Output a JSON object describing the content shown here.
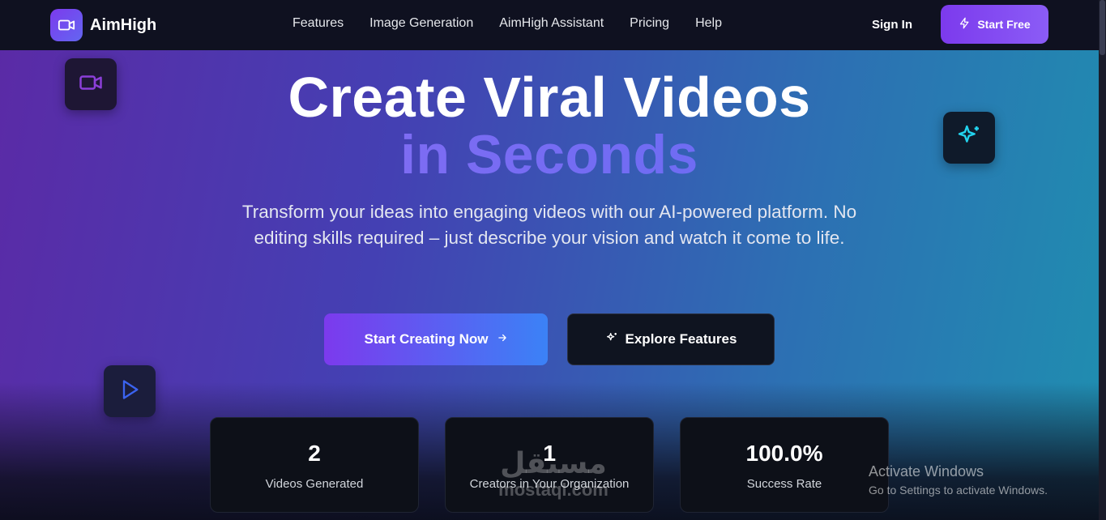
{
  "nav": {
    "brand": "AimHigh",
    "links": [
      "Features",
      "Image Generation",
      "AimHigh Assistant",
      "Pricing",
      "Help"
    ],
    "sign_in": "Sign In",
    "start_free": "Start Free"
  },
  "hero": {
    "title_line1": "Create Viral Videos",
    "title_line2": "in Seconds",
    "subtitle": "Transform your ideas into engaging videos with our AI-powered platform. No editing skills required – just describe your vision and watch it come to life.",
    "primary_cta": "Start Creating Now",
    "secondary_cta": "Explore Features"
  },
  "stats": [
    {
      "value": "2",
      "label": "Videos Generated"
    },
    {
      "value": "1",
      "label": "Creators in Your Organization"
    },
    {
      "value": "100.0%",
      "label": "Success Rate"
    }
  ],
  "overlays": {
    "watermark_arabic": "مستقل",
    "watermark_latin": "mostaql.com",
    "activate_title": "Activate Windows",
    "activate_sub": "Go to Settings to activate Windows."
  },
  "icons": {
    "brand": "video-camera-icon",
    "start_free": "lightning-icon",
    "primary_cta": "arrow-right-icon",
    "secondary_cta": "sparkles-icon"
  },
  "colors": {
    "accent_purple": "#7c3aed",
    "accent_blue": "#3b82f6",
    "nav_bg": "#0f1120",
    "card_bg": "#0d1018"
  }
}
